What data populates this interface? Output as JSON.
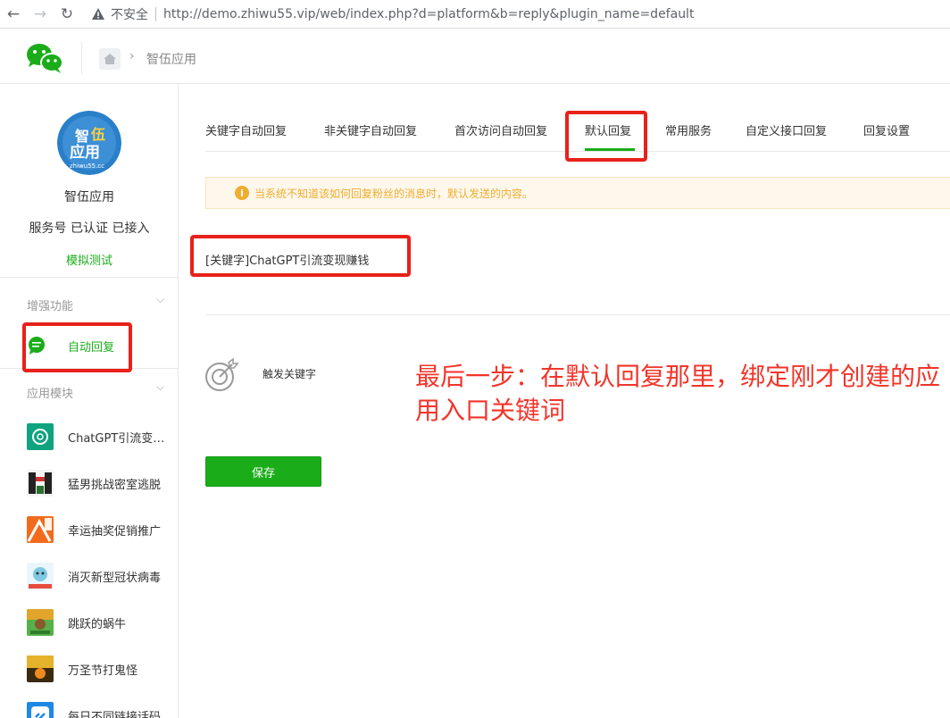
{
  "browser": {
    "back_icon": "back-arrow-icon",
    "forward_icon": "forward-arrow-icon",
    "reload_icon": "reload-icon",
    "insecure_label": "不安全",
    "url": "http://demo.zhiwu55.vip/web/index.php?d=platform&b=reply&plugin_name=default"
  },
  "header": {
    "logo": "wechat-logo-icon",
    "breadcrumb_home": "home-icon",
    "breadcrumb_current": "智伍应用"
  },
  "sidebar": {
    "avatar_text": [
      "智",
      "伍",
      "应用",
      "zhiwu55.cc"
    ],
    "account_name": "智伍应用",
    "account_type": "服务号 已认证 已接入",
    "sim_test_label": "模拟测试",
    "sections": [
      {
        "title": "增强功能",
        "items": [
          {
            "label": "自动回复",
            "active": true,
            "icon": "chat-bubble-icon"
          }
        ]
      },
      {
        "title": "应用模块",
        "items": [
          {
            "label": "ChatGPT引流变现赚钱",
            "icon": "openai-icon"
          },
          {
            "label": "猛男挑战密室逃脱",
            "icon": "escape-room-thumb"
          },
          {
            "label": "幸运抽奖促销推广",
            "icon": "lottery-thumb"
          },
          {
            "label": "消灭新型冠状病毒",
            "icon": "virus-game-thumb"
          },
          {
            "label": "跳跃的蜗牛",
            "icon": "snail-game-thumb"
          },
          {
            "label": "万圣节打鬼怪",
            "icon": "halloween-thumb"
          },
          {
            "label": "每日不同链接话码",
            "icon": "link-thumb"
          }
        ]
      }
    ]
  },
  "tabs": [
    {
      "label": "关键字自动回复"
    },
    {
      "label": "非关键字自动回复"
    },
    {
      "label": "首次访问自动回复"
    },
    {
      "label": "默认回复",
      "active": true
    },
    {
      "label": "常用服务"
    },
    {
      "label": "自定义接口回复"
    },
    {
      "label": "回复设置"
    }
  ],
  "notice": {
    "icon": "info-icon",
    "text": "当系统不知道该如何回复粉丝的消息时，默认发送的内容。"
  },
  "reply": {
    "content": "[关键字]ChatGPT引流变现赚钱",
    "trigger_icon": "target-icon",
    "trigger_label": "触发关键字"
  },
  "annotation": {
    "text": "最后一步：在默认回复那里，绑定刚才创建的应用入口关键词"
  },
  "save_button": {
    "label": "保存"
  },
  "colors": {
    "brand_green": "#1aad19",
    "highlight_red": "#e8211a",
    "annotation_red": "#f2352a",
    "notice_orange": "#f0ad2e"
  }
}
